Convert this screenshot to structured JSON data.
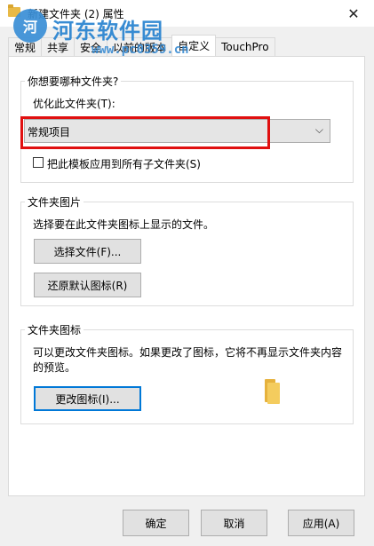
{
  "window": {
    "title": "新建文件夹 (2) 属性",
    "close_glyph": "✕"
  },
  "watermark": {
    "name": "河东软件园",
    "url": "www.pc0359.cn",
    "logo_text": "河"
  },
  "tabs": [
    {
      "label": "常规",
      "active": false
    },
    {
      "label": "共享",
      "active": false
    },
    {
      "label": "安全",
      "active": false
    },
    {
      "label": "以前的版本",
      "active": false
    },
    {
      "label": "自定义",
      "active": true
    },
    {
      "label": "TouchPro",
      "active": false
    }
  ],
  "folder_type": {
    "legend": "你想要哪种文件夹?",
    "optimize_label": "优化此文件夹(T):",
    "selected": "常规项目",
    "apply_subfolders_label": "把此模板应用到所有子文件夹(S)",
    "apply_subfolders_checked": false
  },
  "folder_pictures": {
    "legend": "文件夹图片",
    "description": "选择要在此文件夹图标上显示的文件。",
    "choose_file": "选择文件(F)...",
    "restore_default": "还原默认图标(R)"
  },
  "folder_icons": {
    "legend": "文件夹图标",
    "description_line1": "可以更改文件夹图标。如果更改了图标，它将不再显示文件夹内容",
    "description_line2": "的预览。",
    "change_icon": "更改图标(I)..."
  },
  "footer": {
    "ok": "确定",
    "cancel": "取消",
    "apply": "应用(A)"
  },
  "colors": {
    "highlight": "#e01010",
    "focus": "#0078d7",
    "watermark": "#2e86d1"
  }
}
